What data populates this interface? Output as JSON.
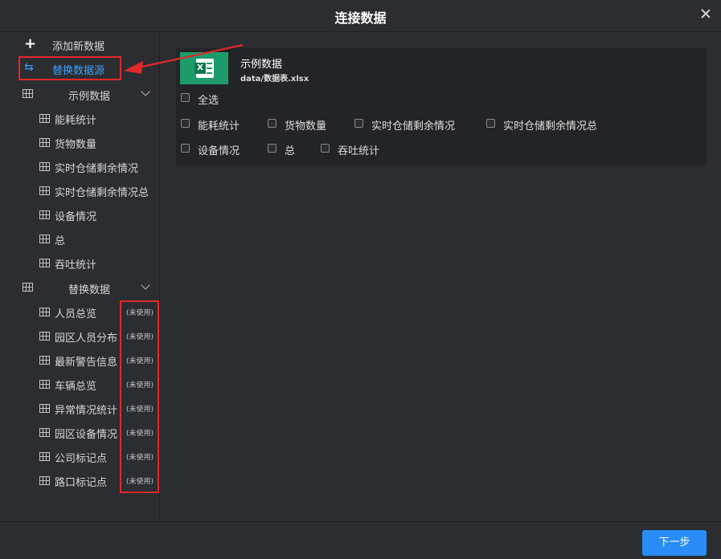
{
  "dialog": {
    "title": "连接数据"
  },
  "sidebar": {
    "add_label": "添加新数据",
    "replace_label": "替换数据源",
    "groups": [
      {
        "name": "示例数据",
        "items": [
          "能耗统计",
          "货物数量",
          "实时仓储剩余情况",
          "实时仓储剩余情况总",
          "设备情况",
          "总",
          "吞吐统计"
        ]
      },
      {
        "name": "替换数据",
        "items": [
          "人员总览",
          "园区人员分布",
          "最新警告信息",
          "车辆总览",
          "异常情况统计",
          "园区设备情况",
          "公司标记点",
          "路口标记点"
        ],
        "status": "(未使用)"
      }
    ]
  },
  "source": {
    "name": "示例数据",
    "path": "data/数据表.xlsx",
    "select_all": "全选",
    "sheets": [
      "能耗统计",
      "货物数量",
      "实时仓储剩余情况",
      "实时仓储剩余情况总",
      "设备情况",
      "总",
      "吞吐统计"
    ]
  },
  "footer": {
    "next_label": "下一步"
  },
  "colors": {
    "accent": "#2a8cf7",
    "highlight": "#e0282b",
    "excel": "#1d9b6c"
  }
}
